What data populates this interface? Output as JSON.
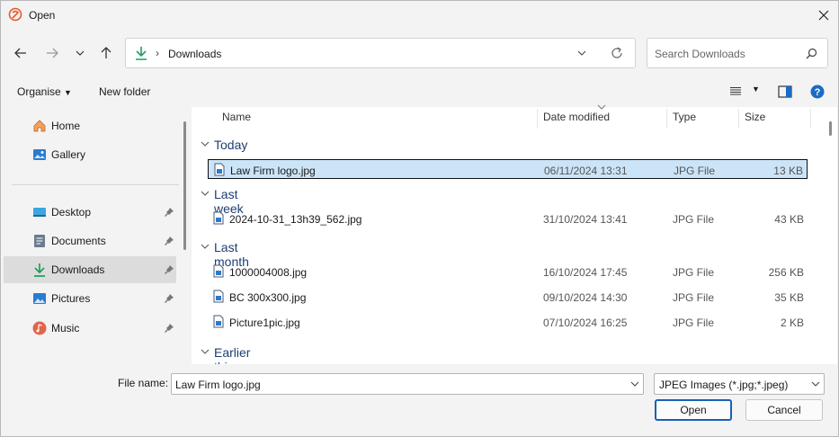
{
  "window": {
    "title": "Open",
    "close_icon": "close-icon"
  },
  "address": {
    "folder": "Downloads"
  },
  "search": {
    "placeholder": "Search Downloads"
  },
  "toolbar": {
    "organise": "Organise",
    "new_folder": "New folder"
  },
  "sidebar": {
    "items": [
      {
        "label": "Home",
        "icon": "home-icon",
        "pinned": false
      },
      {
        "label": "Gallery",
        "icon": "gallery-icon",
        "pinned": false
      },
      {
        "label": "Desktop",
        "icon": "desktop-icon",
        "pinned": true
      },
      {
        "label": "Documents",
        "icon": "documents-icon",
        "pinned": true
      },
      {
        "label": "Downloads",
        "icon": "download-icon",
        "pinned": true,
        "selected": true
      },
      {
        "label": "Pictures",
        "icon": "pictures-icon",
        "pinned": true
      },
      {
        "label": "Music",
        "icon": "music-icon",
        "pinned": true
      }
    ]
  },
  "columns": {
    "name": "Name",
    "date": "Date modified",
    "type": "Type",
    "size": "Size"
  },
  "groups": [
    {
      "label": "Today",
      "files": [
        {
          "name": "Law Firm logo.jpg",
          "date": "06/11/2024 13:31",
          "type": "JPG File",
          "size": "13 KB",
          "selected": true
        }
      ]
    },
    {
      "label": "Last week",
      "files": [
        {
          "name": "2024-10-31_13h39_562.jpg",
          "date": "31/10/2024 13:41",
          "type": "JPG File",
          "size": "43 KB"
        }
      ]
    },
    {
      "label": "Last month",
      "files": [
        {
          "name": "1000004008.jpg",
          "date": "16/10/2024 17:45",
          "type": "JPG File",
          "size": "256 KB"
        },
        {
          "name": "BC 300x300.jpg",
          "date": "09/10/2024 14:30",
          "type": "JPG File",
          "size": "35 KB"
        },
        {
          "name": "Picture1pic.jpg",
          "date": "07/10/2024 16:25",
          "type": "JPG File",
          "size": "2 KB"
        }
      ]
    },
    {
      "label": "Earlier this year",
      "files": []
    }
  ],
  "footer": {
    "file_name_label": "File name:",
    "file_name_value": "Law Firm logo.jpg",
    "file_type": "JPEG Images (*.jpg;*.jpeg)",
    "open": "Open",
    "cancel": "Cancel"
  },
  "colors": {
    "accent": "#0067c0",
    "selection": "#cce4f7",
    "group_text": "#1e3d73",
    "download_green": "#1f9e5c"
  }
}
